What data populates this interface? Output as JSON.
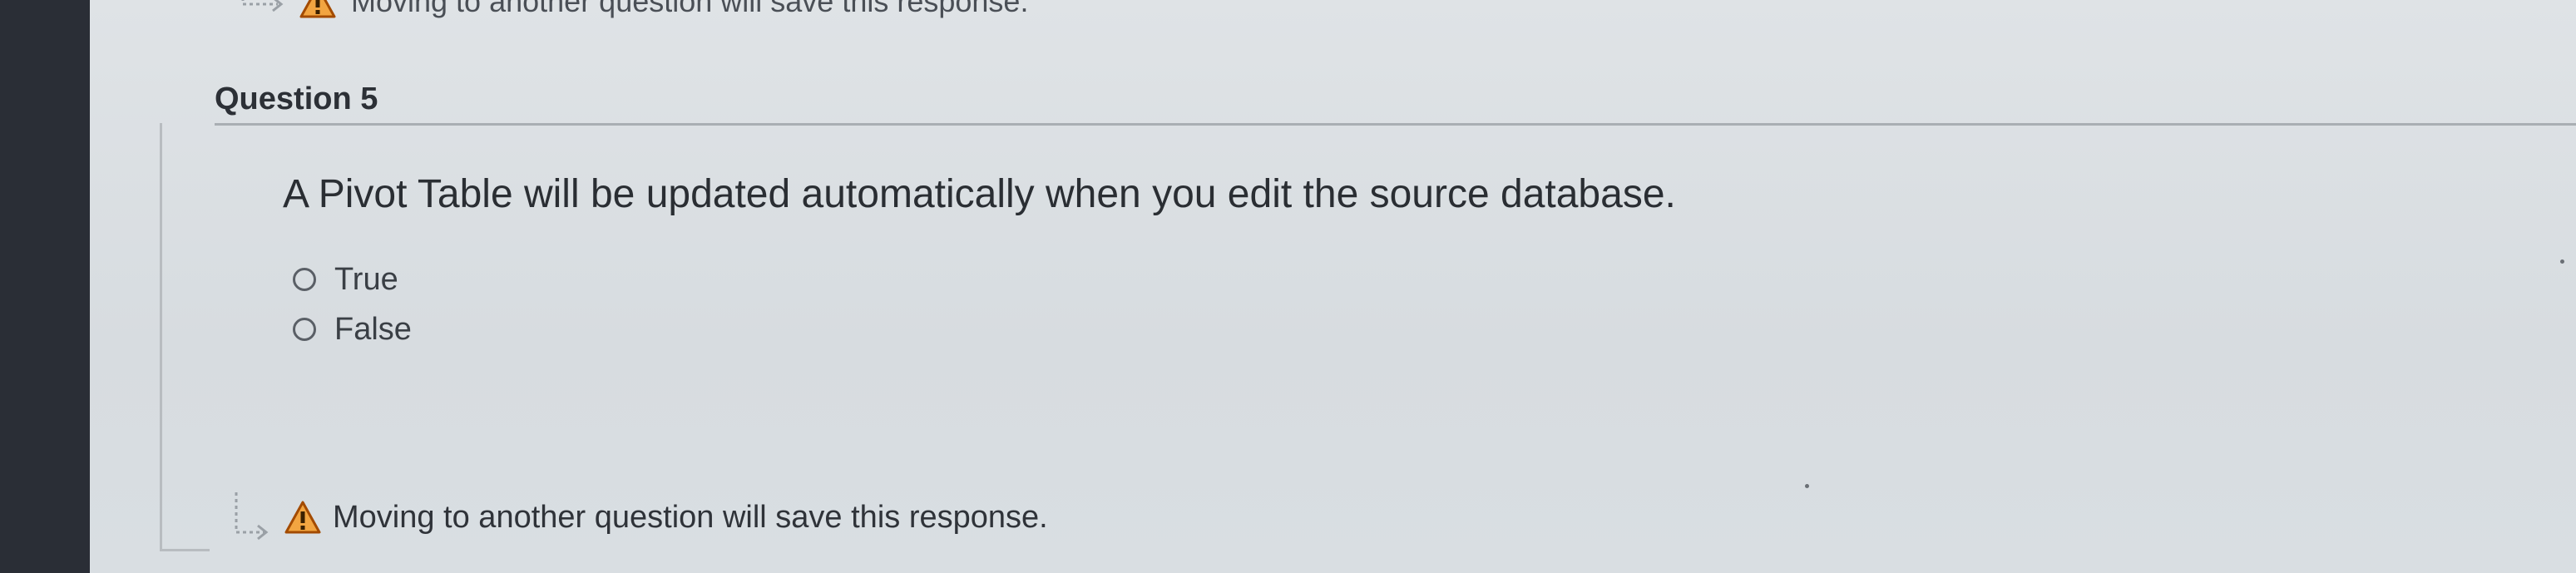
{
  "top_note": {
    "icon": "warning-icon",
    "text": "Moving to another question will save this response."
  },
  "question": {
    "title": "Question 5",
    "text": "A Pivot Table will be updated automatically when you edit the source database.",
    "options": [
      {
        "label": "True",
        "selected": false
      },
      {
        "label": "False",
        "selected": false
      }
    ]
  },
  "bottom_note": {
    "icon": "warning-icon",
    "text": "Moving to another question will save this response."
  },
  "colors": {
    "sidebar": "#2a2e36",
    "warning_fill": "#f2a541",
    "warning_stroke": "#a34b00"
  }
}
